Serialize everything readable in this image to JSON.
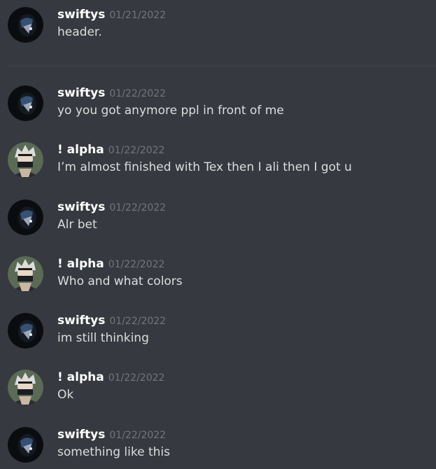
{
  "users": {
    "swiftys": {
      "name": "swiftys",
      "avatar": "swiftys-avatar"
    },
    "alpha": {
      "name": "! alpha",
      "avatar": "alpha-avatar"
    }
  },
  "messages": [
    {
      "author": "swiftys",
      "timestamp": "01/21/2022",
      "text": "header."
    },
    {
      "author": "swiftys",
      "timestamp": "01/22/2022",
      "text": "yo you got anymore ppl in front of me"
    },
    {
      "author": "! alpha",
      "timestamp": "01/22/2022",
      "text": "I’m almost finished with Tex then I ali then I got u"
    },
    {
      "author": "swiftys",
      "timestamp": "01/22/2022",
      "text": "Alr bet"
    },
    {
      "author": "! alpha",
      "timestamp": "01/22/2022",
      "text": "Who and what colors"
    },
    {
      "author": "swiftys",
      "timestamp": "01/22/2022",
      "text": "im still thinking"
    },
    {
      "author": "! alpha",
      "timestamp": "01/22/2022",
      "text": "Ok"
    },
    {
      "author": "swiftys",
      "timestamp": "01/22/2022",
      "text": "something like this"
    }
  ],
  "colors": {
    "background": "#36393f",
    "username": "#ffffff",
    "timestamp": "#72767d",
    "message_text": "#dcddde",
    "divider": "#42454a"
  }
}
